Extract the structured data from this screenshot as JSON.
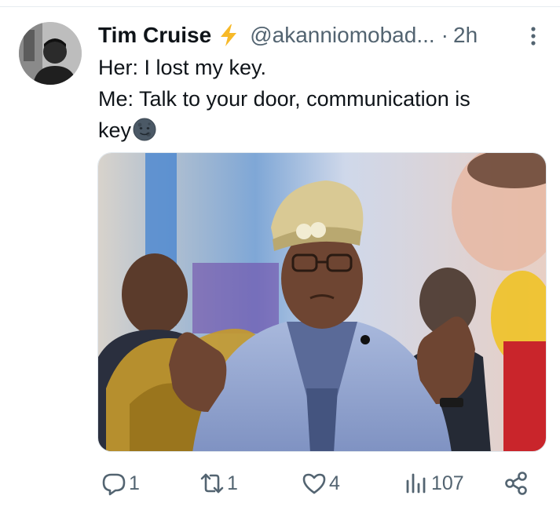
{
  "tweet": {
    "author_name": "Tim Cruise",
    "author_handle": "@akanniomobad...",
    "separator": "·",
    "time": "2h",
    "text_lines": [
      "Her: I lost my key.",
      "Me: Talk to your door, communication is",
      "key"
    ],
    "emoji": "new-moon-face",
    "badge_icon": "lightning-bolt-icon"
  },
  "actions": {
    "replies": "1",
    "retweets": "1",
    "likes": "4",
    "views": "107"
  },
  "colors": {
    "text": "#0f1419",
    "muted": "#536471",
    "bolt": "#f7b928",
    "divider": "#e6ecf0"
  }
}
